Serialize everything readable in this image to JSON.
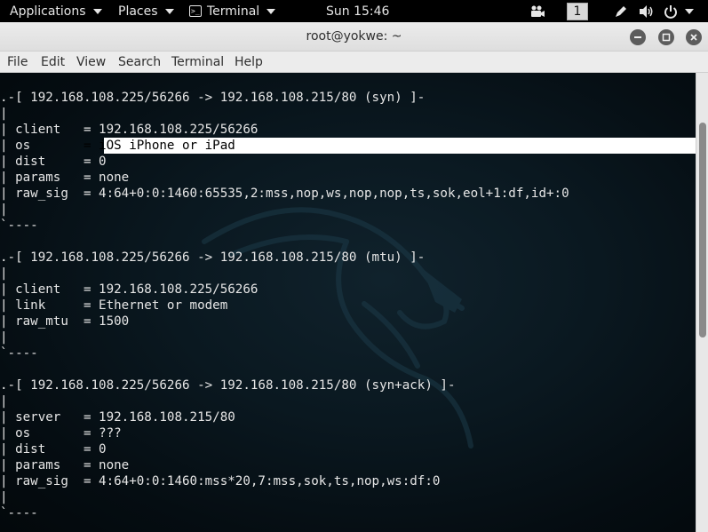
{
  "topbar": {
    "applications": "Applications",
    "places": "Places",
    "terminal": "Terminal",
    "clock": "Sun 15:46",
    "workspace": "1"
  },
  "window": {
    "title": "root@yokwe: ~"
  },
  "menu": [
    "File",
    "Edit",
    "View",
    "Search",
    "Terminal",
    "Help"
  ],
  "terminal": {
    "highlighted_line": 3,
    "lines": [
      ".-[ 192.168.108.225/56266 -> 192.168.108.215/80 (syn) ]-",
      "|",
      "| client   = 192.168.108.225/56266",
      "| os       = iOS iPhone or iPad",
      "| dist     = 0",
      "| params   = none",
      "| raw_sig  = 4:64+0:0:1460:65535,2:mss,nop,ws,nop,nop,ts,sok,eol+1:df,id+:0",
      "|",
      "`----",
      "",
      ".-[ 192.168.108.225/56266 -> 192.168.108.215/80 (mtu) ]-",
      "|",
      "| client   = 192.168.108.225/56266",
      "| link     = Ethernet or modem",
      "| raw_mtu  = 1500",
      "|",
      "`----",
      "",
      ".-[ 192.168.108.225/56266 -> 192.168.108.215/80 (syn+ack) ]-",
      "|",
      "| server   = 192.168.108.215/80",
      "| os       = ???",
      "| dist     = 0",
      "| params   = none",
      "| raw_sig  = 4:64+0:0:1460:mss*20,7:mss,sok,ts,nop,ws:df:0",
      "|",
      "`----"
    ]
  },
  "colors": {
    "terminal_text": "#e6e6e6",
    "highlight_bg": "#ffffff",
    "topbar_bg": "#000000",
    "chrome_bg": "#ececec"
  }
}
